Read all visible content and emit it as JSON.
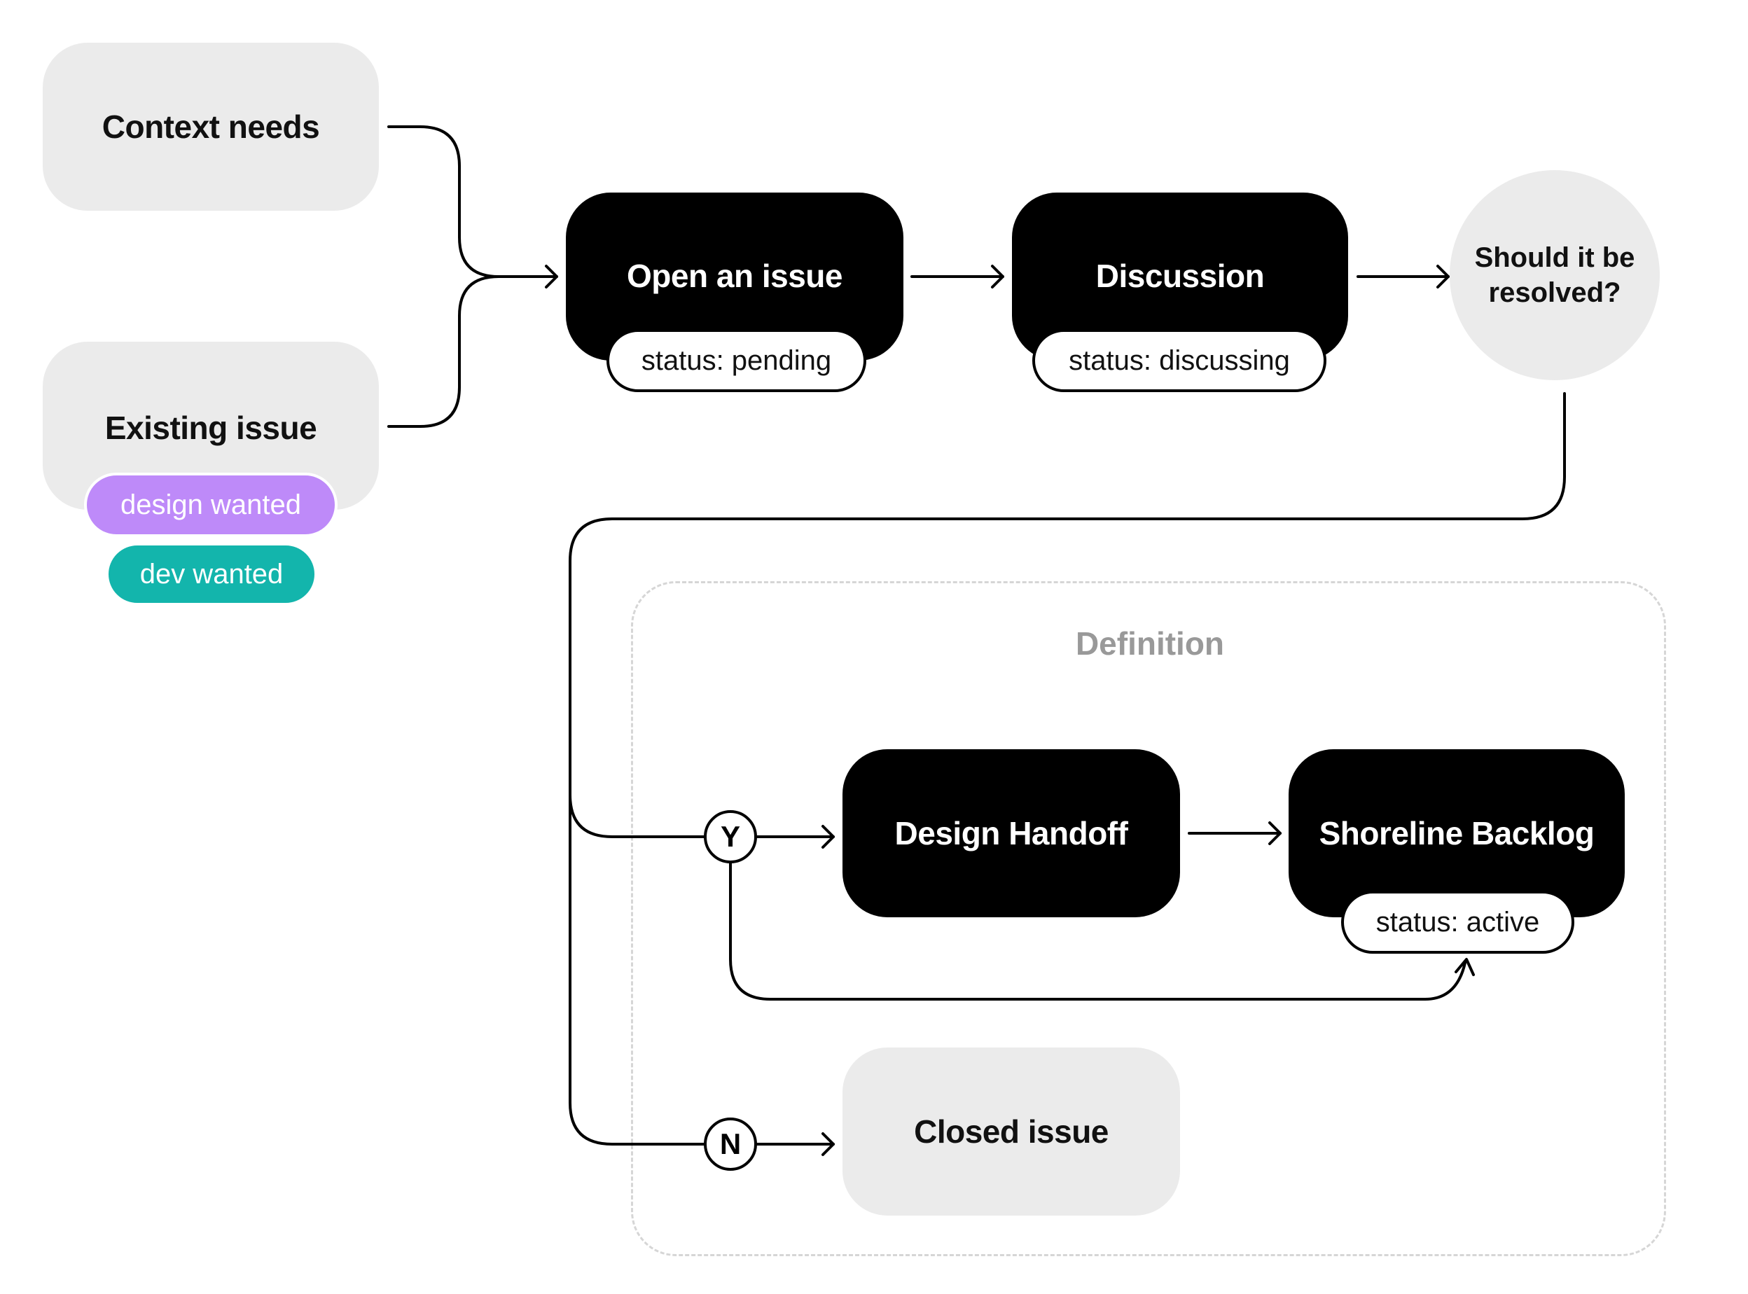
{
  "inputs": {
    "context_needs": "Context needs",
    "existing_issue": "Existing issue",
    "tags": [
      {
        "label": "design wanted",
        "color": "#BE8AF9"
      },
      {
        "label": "dev wanted",
        "color": "#13B5AC"
      }
    ]
  },
  "flow": {
    "open_issue": {
      "label": "Open an issue",
      "status": "status: pending"
    },
    "discussion": {
      "label": "Discussion",
      "status": "status: discussing"
    },
    "decision": {
      "line1": "Should it be",
      "line2": "resolved?"
    }
  },
  "definition": {
    "title": "Definition",
    "yes_label": "Y",
    "no_label": "N",
    "design_handoff": "Design Handoff",
    "shoreline_backlog": {
      "label": "Shoreline Backlog",
      "status": "status: active"
    },
    "closed_issue": "Closed issue"
  },
  "colors": {
    "node_dark": "#000000",
    "node_light": "#EBEBEB",
    "group_border": "#D6D6D6",
    "group_label": "#999999"
  }
}
